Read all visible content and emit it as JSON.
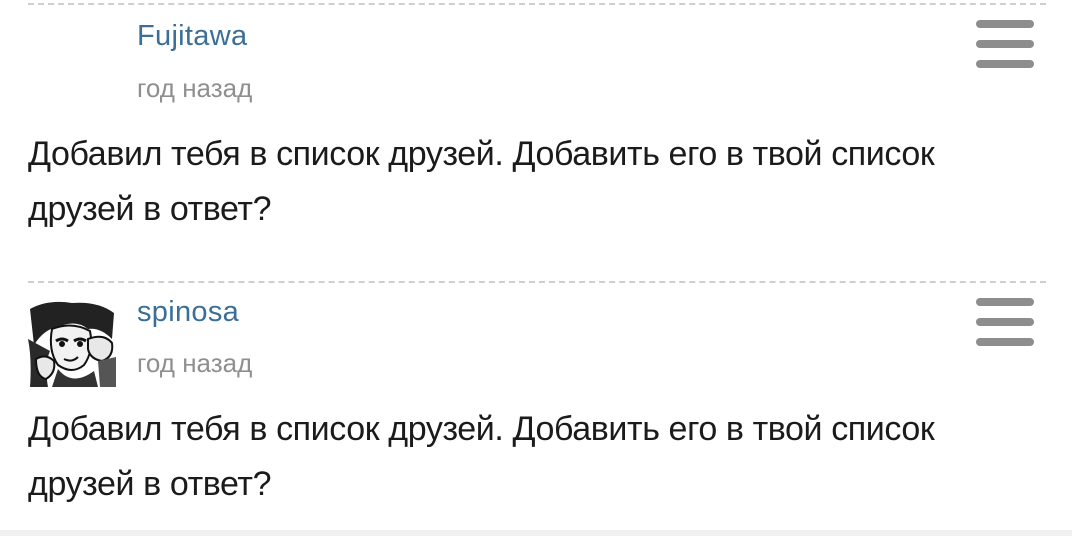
{
  "comments": [
    {
      "author": "Fujitawa",
      "time": "год назад",
      "text": "Добавил тебя в список друзей. Добавить его в твой список друзей в ответ?",
      "has_avatar": false,
      "menu_icon": "hamburger-menu-icon"
    },
    {
      "author": "spinosa",
      "time": "год назад",
      "text": "Добавил тебя в список друзей. Добавить его в твой список друзей в ответ?",
      "has_avatar": true,
      "menu_icon": "hamburger-menu-icon"
    }
  ],
  "colors": {
    "author": "#3b6f97",
    "time": "#8f8f8f",
    "text": "#1b1b1b",
    "menu_icon": "#8d8d8d",
    "divider": "#cfcfcf"
  }
}
